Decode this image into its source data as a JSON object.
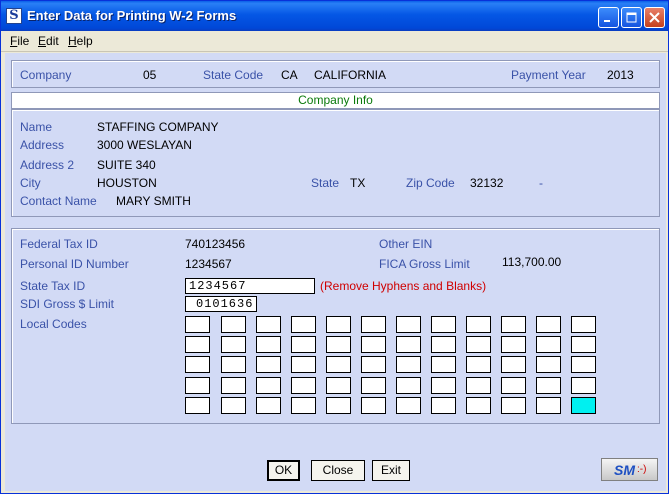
{
  "window": {
    "title": "Enter Data for Printing W-2 Forms",
    "app_icon_letter": "S"
  },
  "menu": [
    {
      "label": "File",
      "mnemonic": "F",
      "rest": "ile"
    },
    {
      "label": "Edit",
      "mnemonic": "E",
      "rest": "dit"
    },
    {
      "label": "Help",
      "mnemonic": "H",
      "rest": "elp"
    }
  ],
  "company_row": {
    "company_label": "Company",
    "company_value": "05",
    "state_code_label": "State Code",
    "state_code": "CA",
    "state_name": "CALIFORNIA",
    "payment_year_label": "Payment Year",
    "payment_year": "2013"
  },
  "company_info": {
    "header": "Company Info",
    "name_label": "Name",
    "name": "STAFFING COMPANY",
    "address_label": "Address",
    "address": "3000 WESLAYAN",
    "address2_label": "Address 2",
    "address2": "SUITE 340",
    "city_label": "City",
    "city": "HOUSTON",
    "state_label": "State",
    "state": "TX",
    "zip_label": "Zip Code",
    "zip": "32132",
    "zip_ext": "-",
    "contact_label": "Contact Name",
    "contact": "MARY SMITH"
  },
  "tax": {
    "federal_label": "Federal Tax ID",
    "federal_value": "740123456",
    "other_ein_label": "Other EIN",
    "personal_label": "Personal ID Number",
    "personal_value": "1234567",
    "fica_label": "FICA Gross Limit",
    "fica_value": "113,700.00",
    "state_tax_label": "State Tax ID",
    "state_tax_value": "1234567",
    "state_tax_hint": "(Remove Hyphens and Blanks)",
    "sdi_label": "SDI Gross $ Limit",
    "sdi_value": "0101636",
    "local_codes_label": "Local Codes"
  },
  "buttons": {
    "ok": "OK",
    "close": "Close",
    "exit": "Exit"
  },
  "logo": {
    "text": "SM",
    "smiley": ":-)"
  },
  "colors": {
    "label_blue": "#3a52a8",
    "info_green": "#0b7a0b",
    "warning_red": "#d00000",
    "active_cell": "#00F0F0",
    "client_bg": "#D2DAF5"
  }
}
